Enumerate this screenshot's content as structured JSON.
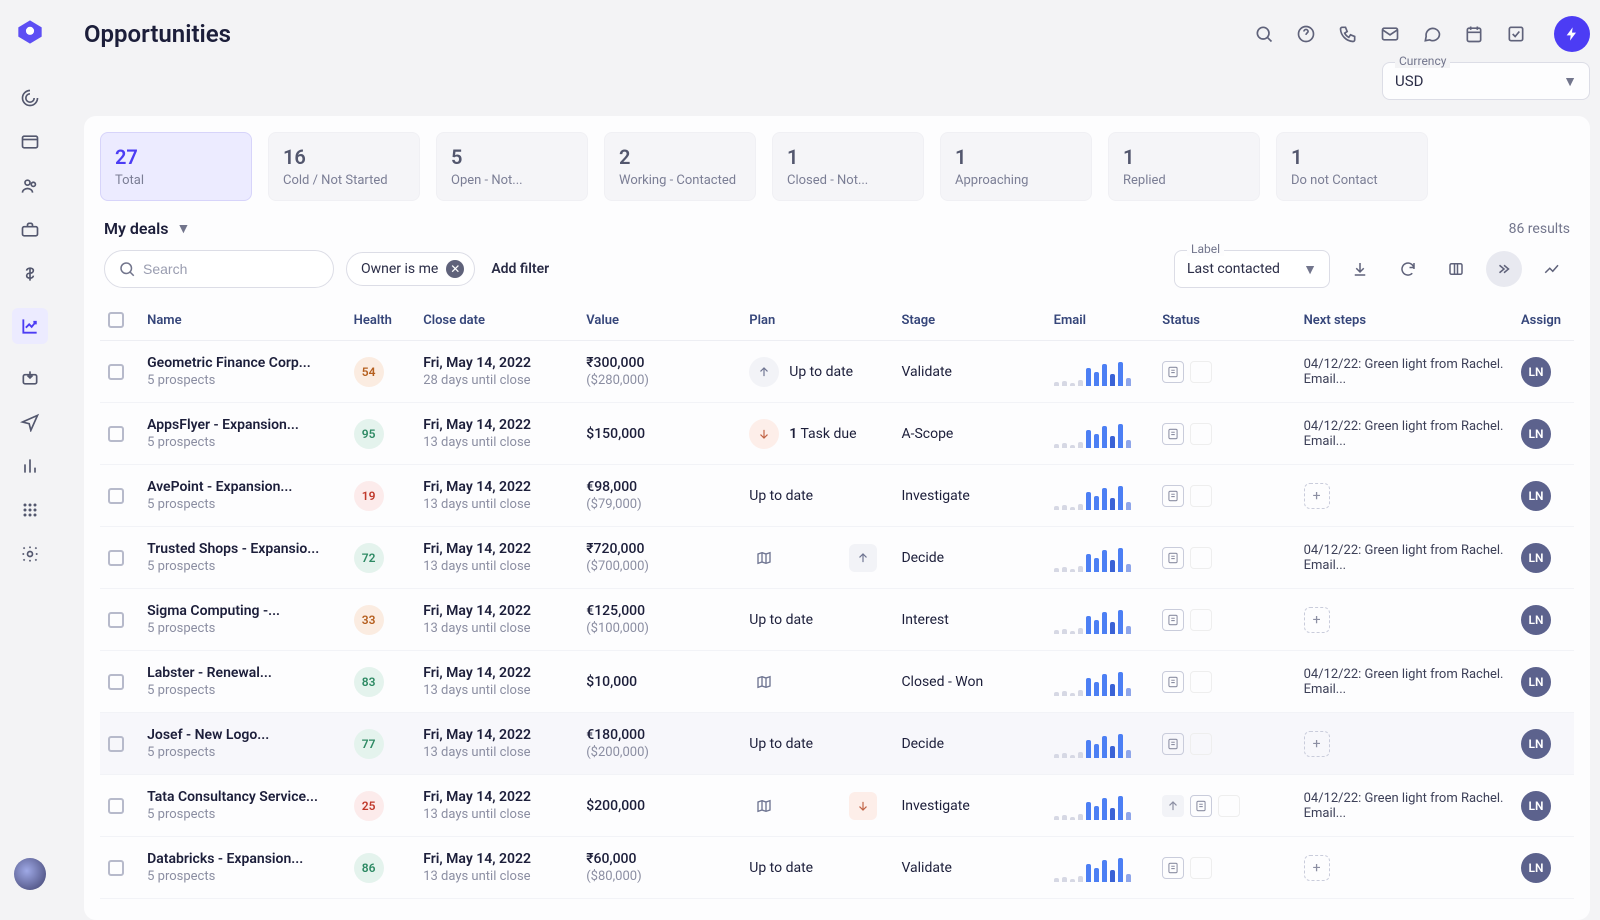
{
  "header": {
    "title": "Opportunities",
    "currency_label": "Currency",
    "currency_value": "USD"
  },
  "status_cards": [
    {
      "count": "27",
      "label": "Total",
      "active": true
    },
    {
      "count": "16",
      "label": "Cold / Not Started"
    },
    {
      "count": "5",
      "label": "Open - Not..."
    },
    {
      "count": "2",
      "label": "Working - Contacted"
    },
    {
      "count": "1",
      "label": "Closed - Not..."
    },
    {
      "count": "1",
      "label": "Approaching"
    },
    {
      "count": "1",
      "label": "Replied"
    },
    {
      "count": "1",
      "label": "Do not Contact"
    }
  ],
  "toolbar": {
    "deals_label": "My deals",
    "results_text": "86 results",
    "search_placeholder": "Search",
    "filter_chip": "Owner is me",
    "add_filter": "Add filter",
    "label_label": "Label",
    "label_value": "Last contacted"
  },
  "columns": {
    "checkbox": "",
    "name": "Name",
    "health": "Health",
    "close": "Close date",
    "value": "Value",
    "plan": "Plan",
    "stage": "Stage",
    "email": "Email",
    "status": "Status",
    "next": "Next steps",
    "assign": "Assign"
  },
  "rows": [
    {
      "name": "Geometric Finance Corp...",
      "sub": "5 prospects",
      "health": "54",
      "health_cls": "health-orange",
      "date": "Fri, May 14, 2022",
      "date_sub": "28 days until close",
      "value": "₹300,000",
      "value_sub": "($280,000)",
      "plan_icon": "up",
      "plan_text": "Up to date",
      "stage": "Validate",
      "next": "04/12/22: Green light from Rachel. Email...",
      "assign": "LN"
    },
    {
      "name": "AppsFlyer - Expansion...",
      "sub": "5 prospects",
      "health": "95",
      "health_cls": "health-green",
      "date": "Fri, May 14, 2022",
      "date_sub": "13 days until close",
      "value": "$150,000",
      "value_sub": "",
      "plan_icon": "down",
      "plan_text": "Task due",
      "plan_prefix": "1",
      "stage": "A-Scope",
      "next": "04/12/22: Green light from Rachel. Email...",
      "assign": "LN"
    },
    {
      "name": "AvePoint - Expansion...",
      "sub": "5 prospects",
      "health": "19",
      "health_cls": "health-red",
      "date": "Fri, May 14, 2022",
      "date_sub": "13 days until close",
      "value": "€98,000",
      "value_sub": "($79,000)",
      "plan_icon": "",
      "plan_text": "Up to date",
      "stage": "Investigate",
      "next_add": true,
      "assign": "LN"
    },
    {
      "name": "Trusted Shops - Expansio...",
      "sub": "5 prospects",
      "health": "72",
      "health_cls": "health-green",
      "date": "Fri, May 14, 2022",
      "date_sub": "13 days until close",
      "value": "₹720,000",
      "value_sub": "($700,000)",
      "plan_icon": "map",
      "plan_text": "",
      "plan_extra": "up",
      "stage": "Decide",
      "next": "04/12/22: Green light from Rachel. Email...",
      "assign": "LN"
    },
    {
      "name": "Sigma Computing -...",
      "sub": "5 prospects",
      "health": "33",
      "health_cls": "health-orange",
      "date": "Fri, May 14, 2022",
      "date_sub": "13 days until close",
      "value": "€125,000",
      "value_sub": "($100,000)",
      "plan_icon": "",
      "plan_text": "Up to date",
      "stage": "Interest",
      "next_add": true,
      "assign": "LN"
    },
    {
      "name": "Labster - Renewal...",
      "sub": "5 prospects",
      "health": "83",
      "health_cls": "health-green",
      "date": "Fri, May 14, 2022",
      "date_sub": "13 days until close",
      "value": "$10,000",
      "value_sub": "",
      "plan_icon": "map",
      "plan_text": "",
      "stage": "Closed - Won",
      "next": "04/12/22: Green light from Rachel. Email...",
      "assign": "LN"
    },
    {
      "name": "Josef - New Logo...",
      "sub": "5 prospects",
      "health": "77",
      "health_cls": "health-green",
      "date": "Fri, May 14, 2022",
      "date_sub": "13 days until close",
      "value": "€180,000",
      "value_sub": "($200,000)",
      "plan_icon": "",
      "plan_text": "Up to date",
      "stage": "Decide",
      "highlight": true,
      "next_add": true,
      "assign": "LN"
    },
    {
      "name": "Tata Consultancy Service...",
      "sub": "5 prospects",
      "health": "25",
      "health_cls": "health-red",
      "date": "Fri, May 14, 2022",
      "date_sub": "13 days until close",
      "value": "$200,000",
      "value_sub": "",
      "plan_icon": "map",
      "plan_text": "",
      "plan_extra": "down",
      "stage": "Investigate",
      "status_extra": "up",
      "next": "04/12/22: Green light from Rachel. Email...",
      "assign": "LN"
    },
    {
      "name": "Databricks - Expansion...",
      "sub": "5 prospects",
      "health": "86",
      "health_cls": "health-green",
      "date": "Fri, May 14, 2022",
      "date_sub": "13 days until close",
      "value": "₹60,000",
      "value_sub": "($80,000)",
      "plan_icon": "",
      "plan_text": "Up to date",
      "stage": "Validate",
      "next_add": true,
      "assign": "LN"
    }
  ]
}
